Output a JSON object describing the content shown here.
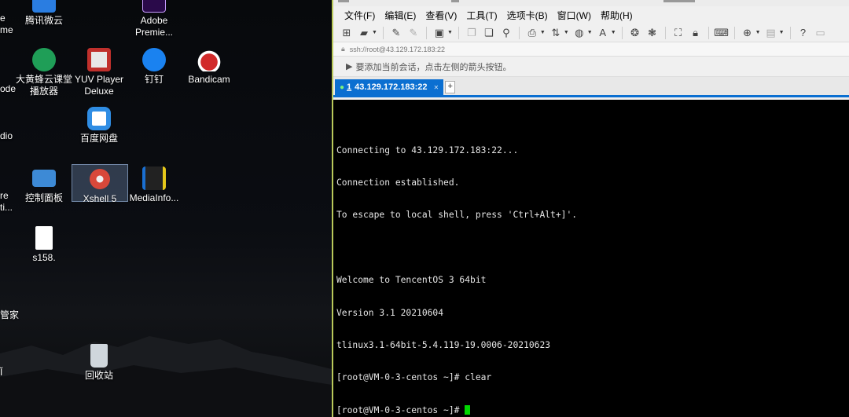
{
  "desktop": {
    "icons": [
      {
        "label": "腾讯微云",
        "icon": "weiyun-icon",
        "color": "#2a7de1"
      },
      {
        "label": "Adobe Premie...",
        "icon": "premiere-icon",
        "color": "#2a0a4a"
      },
      {
        "label": "大黄蜂云课堂播放器",
        "icon": "bumblebee-player-icon",
        "color": "#1f9e57"
      },
      {
        "label": "YUV Player Deluxe",
        "icon": "yuv-player-icon",
        "color": "#c0302c"
      },
      {
        "label": "钉钉",
        "icon": "dingtalk-icon",
        "color": "#1a82f0"
      },
      {
        "label": "Bandicam",
        "icon": "bandicam-icon",
        "color": "#d12a2a"
      },
      {
        "label": "百度网盘",
        "icon": "baidu-netdisk-icon",
        "color": "#2f8de4"
      },
      {
        "label": "控制面板",
        "icon": "control-panel-icon",
        "color": "#3d8ad6"
      },
      {
        "label": "Xshell 5",
        "icon": "xshell-icon",
        "color": "#d8483a"
      },
      {
        "label": "MediaInfo...",
        "icon": "mediainfo-icon",
        "color": "#222222"
      },
      {
        "label": "s158.",
        "icon": "document-icon",
        "color": "#ffffff"
      },
      {
        "label": "回收站",
        "icon": "recycle-bin-icon",
        "color": "#cfd6dc"
      }
    ],
    "edge_labels": [
      "e",
      "me",
      "ode",
      "dio",
      "re",
      "ti...",
      "管家",
      "Ĭ"
    ]
  },
  "xshell": {
    "menu": [
      "文件(F)",
      "编辑(E)",
      "查看(V)",
      "工具(T)",
      "选项卡(B)",
      "窗口(W)",
      "帮助(H)"
    ],
    "address": "ssh://root@43.129.172.183:22",
    "hint": "要添加当前会话，点击左侧的箭头按钮。",
    "tab": {
      "number": "1",
      "label": "43.129.172.183:22"
    },
    "terminal_lines": [
      "Connecting to 43.129.172.183:22...",
      "Connection established.",
      "To escape to local shell, press 'Ctrl+Alt+]'.",
      "",
      "Welcome to TencentOS 3 64bit",
      "Version 3.1 20210604",
      "tlinux3.1-64bit-5.4.119-19.0006-20210623",
      "[root@VM-0-3-centos ~]# clear",
      "[root@VM-0-3-centos ~]# "
    ]
  },
  "colors": {
    "accent": "#0b6fd1",
    "cursor": "#00d700",
    "terminal_bg": "#000000"
  }
}
